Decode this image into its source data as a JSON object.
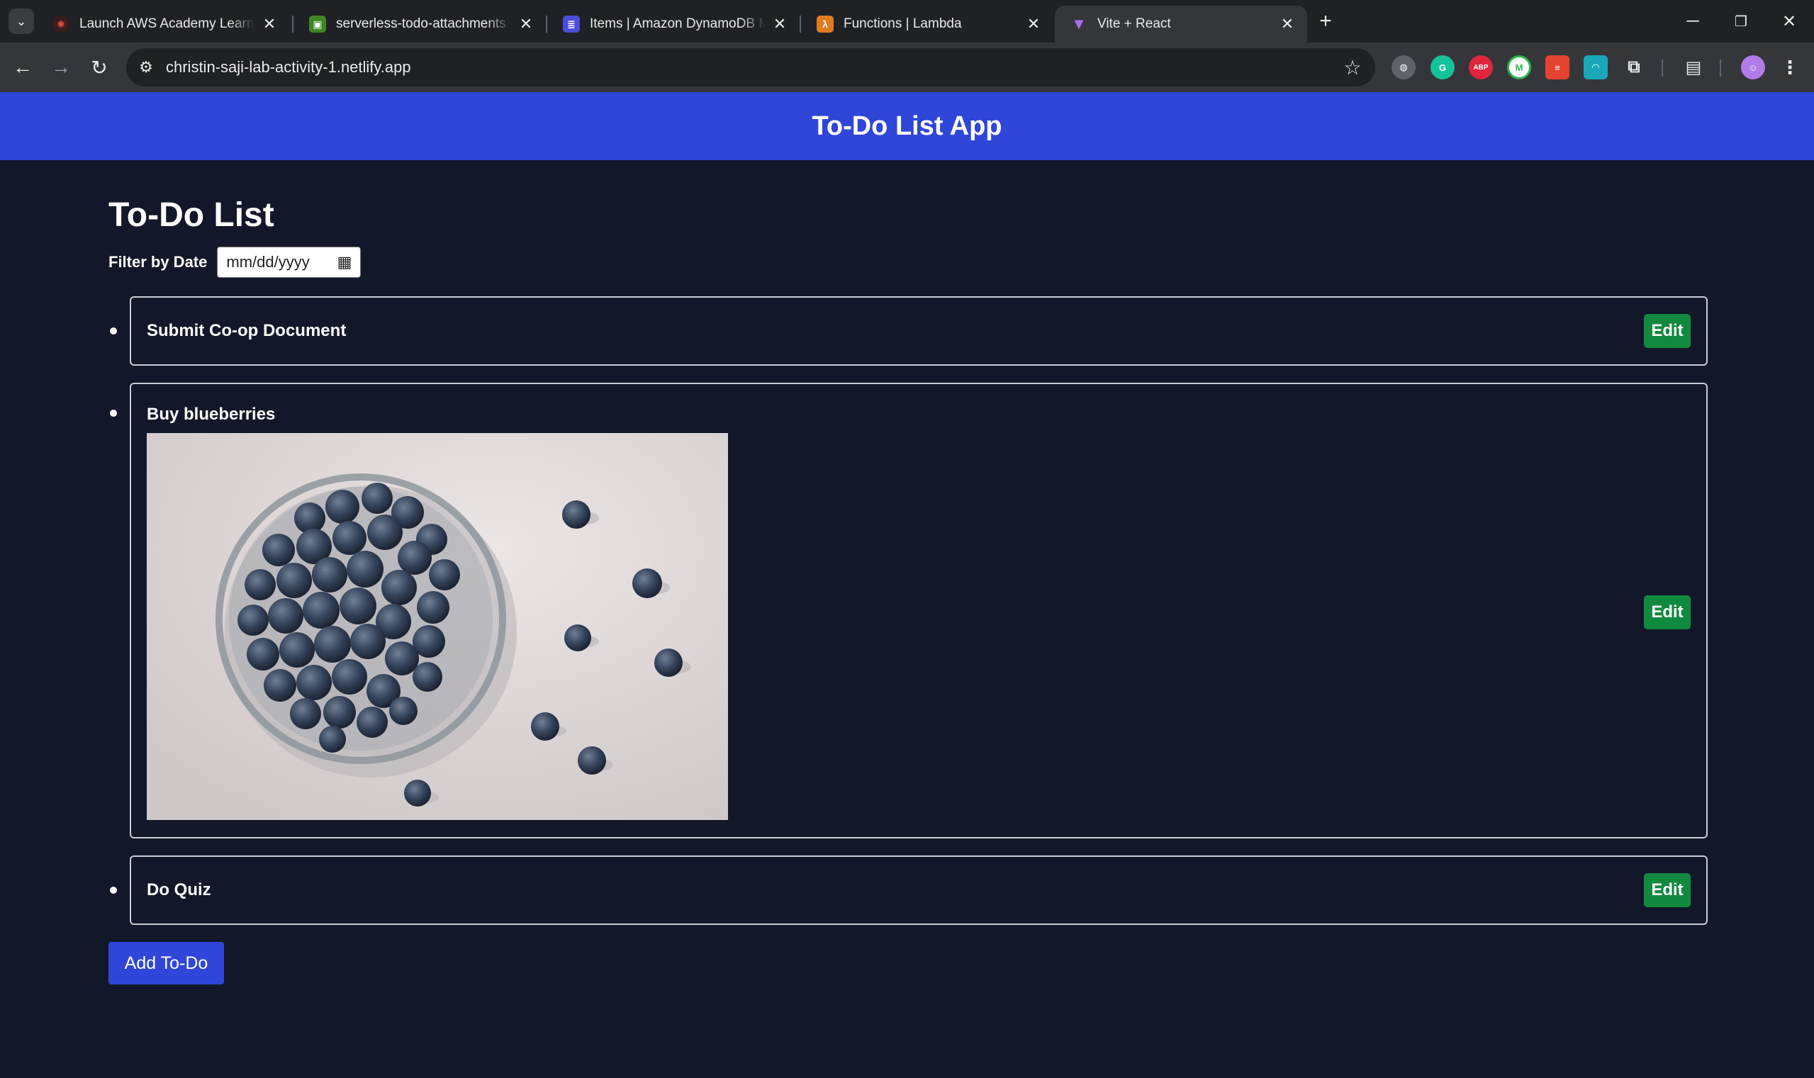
{
  "browser": {
    "tabs": [
      {
        "title": "Launch AWS Academy Learner L",
        "icon": "aws-academy-icon",
        "color": "#d13212"
      },
      {
        "title": "serverless-todo-attachments - S",
        "icon": "s3-bucket-icon",
        "color": "#3f8624"
      },
      {
        "title": "Items | Amazon DynamoDB Ma",
        "icon": "dynamodb-icon",
        "color": "#4d4ddb"
      },
      {
        "title": "Functions | Lambda",
        "icon": "lambda-icon",
        "color": "#e07b1f"
      },
      {
        "title": "Vite + React",
        "icon": "vite-icon",
        "color": "#a855f7"
      }
    ],
    "url": "christin-saji-lab-activity-1.netlify.app",
    "extensions": [
      "globe-icon",
      "grammarly-icon",
      "adblock-plus-icon",
      "momentum-icon",
      "todoist-icon",
      "extension-teal-icon",
      "puzzle-extensions-icon"
    ]
  },
  "app": {
    "header_title": "To-Do List App",
    "page_title": "To-Do List",
    "filter_label": "Filter by Date",
    "date_placeholder": "mm/dd/yyyy",
    "add_button": "Add To-Do",
    "edit_label": "Edit",
    "todos": [
      {
        "title": "Submit Co-op Document",
        "has_image": false
      },
      {
        "title": "Buy blueberries",
        "has_image": true,
        "image": "bowl-of-blueberries-photo"
      },
      {
        "title": "Do Quiz",
        "has_image": false
      }
    ]
  },
  "colors": {
    "header_bg": "#2f46d9",
    "page_bg": "#121829",
    "edit_bg": "#11893f"
  }
}
